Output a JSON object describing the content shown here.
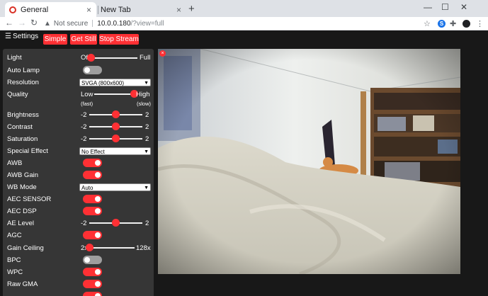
{
  "browser": {
    "tabs": [
      {
        "label": "General",
        "active": true
      },
      {
        "label": "New Tab",
        "active": false
      }
    ],
    "new_tab_symbol": "+",
    "close_symbol": "×",
    "address": {
      "security": "Not secure",
      "host": "10.0.0.180",
      "path": "/?view=full"
    },
    "icons": [
      "back-icon",
      "forward-icon",
      "reload-icon",
      "star-icon",
      "extension-icon",
      "puzzle-icon",
      "profile-icon",
      "menu-icon"
    ]
  },
  "app": {
    "menu_symbol": "☰",
    "title": "Settings",
    "buttons": {
      "simple": "Simple",
      "get_still": "Get Still",
      "stop_stream": "Stop Stream"
    },
    "accent": "#ff3034"
  },
  "controls": {
    "light": {
      "label": "Light",
      "min": "Off",
      "max": "Full",
      "value": 0
    },
    "auto_lamp": {
      "label": "Auto Lamp",
      "on": false
    },
    "resolution": {
      "label": "Resolution",
      "selected": "SVGA (800x600)"
    },
    "quality": {
      "label": "Quality",
      "min": "Low",
      "max": "High",
      "min_hint": "(fast)",
      "max_hint": "(slow)",
      "value": 1.0
    },
    "brightness": {
      "label": "Brightness",
      "min": "-2",
      "max": "2",
      "value": 0.5
    },
    "contrast": {
      "label": "Contrast",
      "min": "-2",
      "max": "2",
      "value": 0.5
    },
    "saturation": {
      "label": "Saturation",
      "min": "-2",
      "max": "2",
      "value": 0.5
    },
    "special_effect": {
      "label": "Special Effect",
      "selected": "No Effect"
    },
    "awb": {
      "label": "AWB",
      "on": true
    },
    "awb_gain": {
      "label": "AWB Gain",
      "on": true
    },
    "wb_mode": {
      "label": "WB Mode",
      "selected": "Auto"
    },
    "aec_sensor": {
      "label": "AEC SENSOR",
      "on": true
    },
    "aec_dsp": {
      "label": "AEC DSP",
      "on": true
    },
    "ae_level": {
      "label": "AE Level",
      "min": "-2",
      "max": "2",
      "value": 0.5
    },
    "agc": {
      "label": "AGC",
      "on": true
    },
    "gain_ceiling": {
      "label": "Gain Ceiling",
      "min": "2x",
      "max": "128x",
      "value": 0
    },
    "bpc": {
      "label": "BPC",
      "on": false
    },
    "wpc": {
      "label": "WPC",
      "on": true
    },
    "raw_gma": {
      "label": "Raw GMA",
      "on": true
    }
  }
}
